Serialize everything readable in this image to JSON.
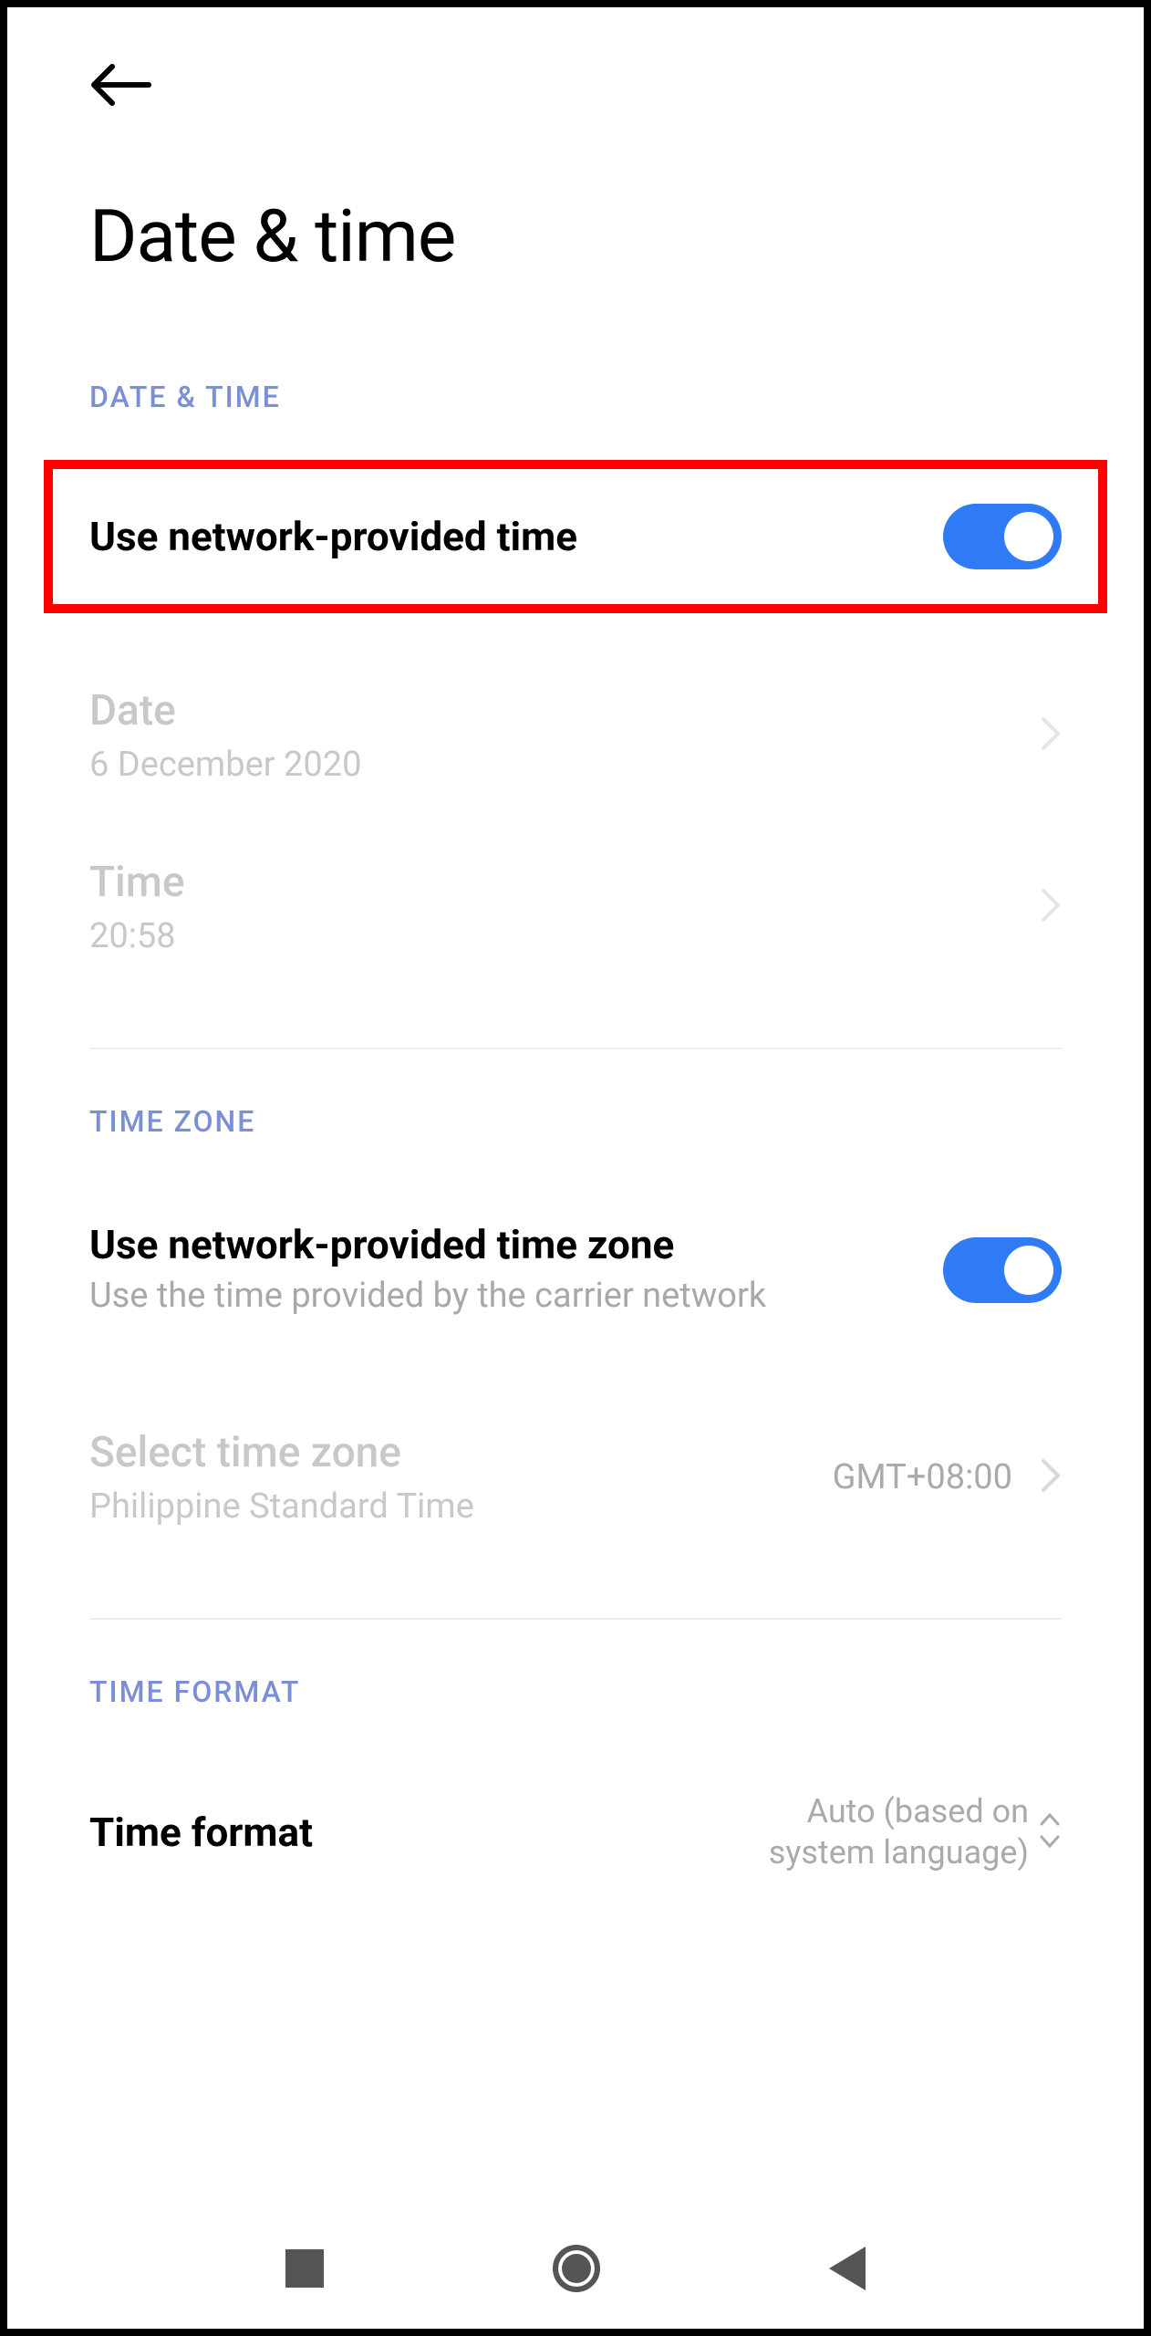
{
  "page": {
    "title": "Date & time"
  },
  "sections": {
    "datetime": {
      "header": "DATE & TIME",
      "network_time": {
        "label": "Use network-provided time",
        "enabled": true
      },
      "date": {
        "label": "Date",
        "value": "6 December 2020"
      },
      "time": {
        "label": "Time",
        "value": "20:58"
      }
    },
    "timezone": {
      "header": "TIME ZONE",
      "network_zone": {
        "label": "Use network-provided time zone",
        "description": "Use the time provided by the carrier network",
        "enabled": true
      },
      "select_zone": {
        "label": "Select time zone",
        "description": "Philippine Standard Time",
        "value": "GMT+08:00"
      }
    },
    "format": {
      "header": "TIME FORMAT",
      "time_format": {
        "label": "Time format",
        "value": "Auto (based on system language)"
      }
    }
  }
}
